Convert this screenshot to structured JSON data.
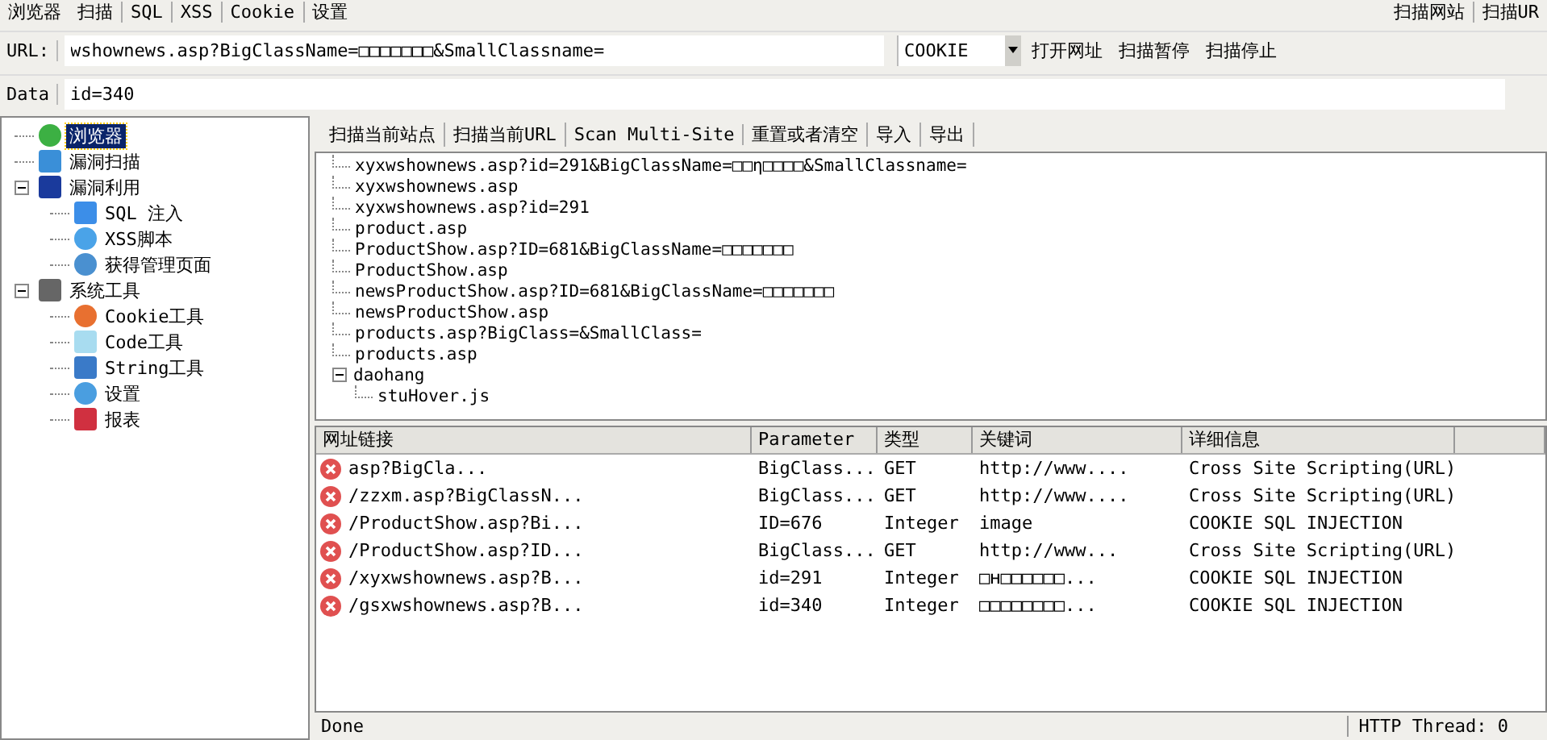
{
  "menu": {
    "left": [
      {
        "label": "浏览器"
      },
      {
        "label": "扫描"
      },
      {
        "label": "SQL"
      },
      {
        "label": "XSS"
      },
      {
        "label": "Cookie"
      },
      {
        "label": "设置"
      }
    ],
    "right": [
      {
        "label": "扫描网站"
      },
      {
        "label": "扫描UR"
      }
    ]
  },
  "url_bar": {
    "label": "URL:",
    "value": "wshownews.asp?BigClassName=□□□□□□□&SmallClassname=",
    "mode": "COOKIE",
    "buttons": [
      "打开网址",
      "扫描暂停",
      "扫描停止"
    ]
  },
  "data_bar": {
    "label": "Data",
    "value": "id=340"
  },
  "sidebar": {
    "items": [
      {
        "label": "浏览器",
        "kind": "check",
        "selected": true
      },
      {
        "label": "漏洞扫描",
        "kind": "search",
        "selected": false
      },
      {
        "label": "漏洞利用",
        "kind": "exploit",
        "selected": false,
        "expanded": true,
        "children": [
          {
            "label": "SQL 注入",
            "kind": "database",
            "selected": false
          },
          {
            "label": "XSS脚本",
            "kind": "xss",
            "selected": false
          },
          {
            "label": "获得管理页面",
            "kind": "user",
            "selected": false
          }
        ]
      },
      {
        "label": "系统工具",
        "kind": "tools",
        "selected": false,
        "expanded": true,
        "children": [
          {
            "label": "Cookie工具",
            "kind": "cookie",
            "selected": false
          },
          {
            "label": "Code工具",
            "kind": "code",
            "selected": false
          },
          {
            "label": "String工具",
            "kind": "string",
            "selected": false
          },
          {
            "label": "设置",
            "kind": "gear",
            "selected": false
          },
          {
            "label": "报表",
            "kind": "chart",
            "selected": false
          }
        ]
      }
    ]
  },
  "toolbar": [
    "扫描当前站点",
    "扫描当前URL",
    "Scan Multi-Site",
    "重置或者清空",
    "导入",
    "导出"
  ],
  "site_tree": [
    {
      "label": "xyxwshownews.asp?id=291&BigClassName=□□η□□□□&SmallClassname="
    },
    {
      "label": "xyxwshownews.asp"
    },
    {
      "label": "xyxwshownews.asp?id=291"
    },
    {
      "label": "product.asp"
    },
    {
      "label": "ProductShow.asp?ID=681&BigClassName=□□□□□□□"
    },
    {
      "label": "ProductShow.asp"
    },
    {
      "label": "newsProductShow.asp?ID=681&BigClassName=□□□□□□□"
    },
    {
      "label": "newsProductShow.asp"
    },
    {
      "label": "products.asp?BigClass=&SmallClass="
    },
    {
      "label": "products.asp"
    },
    {
      "label": "daohang",
      "expanded": true,
      "children": [
        {
          "label": "stuHover.js"
        }
      ]
    }
  ],
  "table": {
    "columns": [
      "网址链接",
      "Parameter",
      "类型",
      "关键词",
      "详细信息"
    ],
    "rows": [
      [
        "asp?BigCla...",
        "BigClass...",
        "GET",
        "http://www....",
        "Cross Site Scripting(URL)"
      ],
      [
        "/zzxm.asp?BigClassN...",
        "BigClass...",
        "GET",
        "http://www....",
        "Cross Site Scripting(URL)"
      ],
      [
        "/ProductShow.asp?Bi...",
        "ID=676",
        "Integer",
        "image",
        "COOKIE SQL INJECTION"
      ],
      [
        "/ProductShow.asp?ID...",
        "BigClass...",
        "GET",
        "http://www...",
        "Cross Site Scripting(URL)"
      ],
      [
        "/xyxwshownews.asp?B...",
        "id=291",
        "Integer",
        "□ʜ□□□□□□...",
        "COOKIE SQL INJECTION"
      ],
      [
        "/gsxwshownews.asp?B...",
        "id=340",
        "Integer",
        "□□□□□□□□...",
        "COOKIE SQL INJECTION"
      ]
    ]
  },
  "status_bar": {
    "message": "Done",
    "threads": "HTTP Thread: 0"
  }
}
